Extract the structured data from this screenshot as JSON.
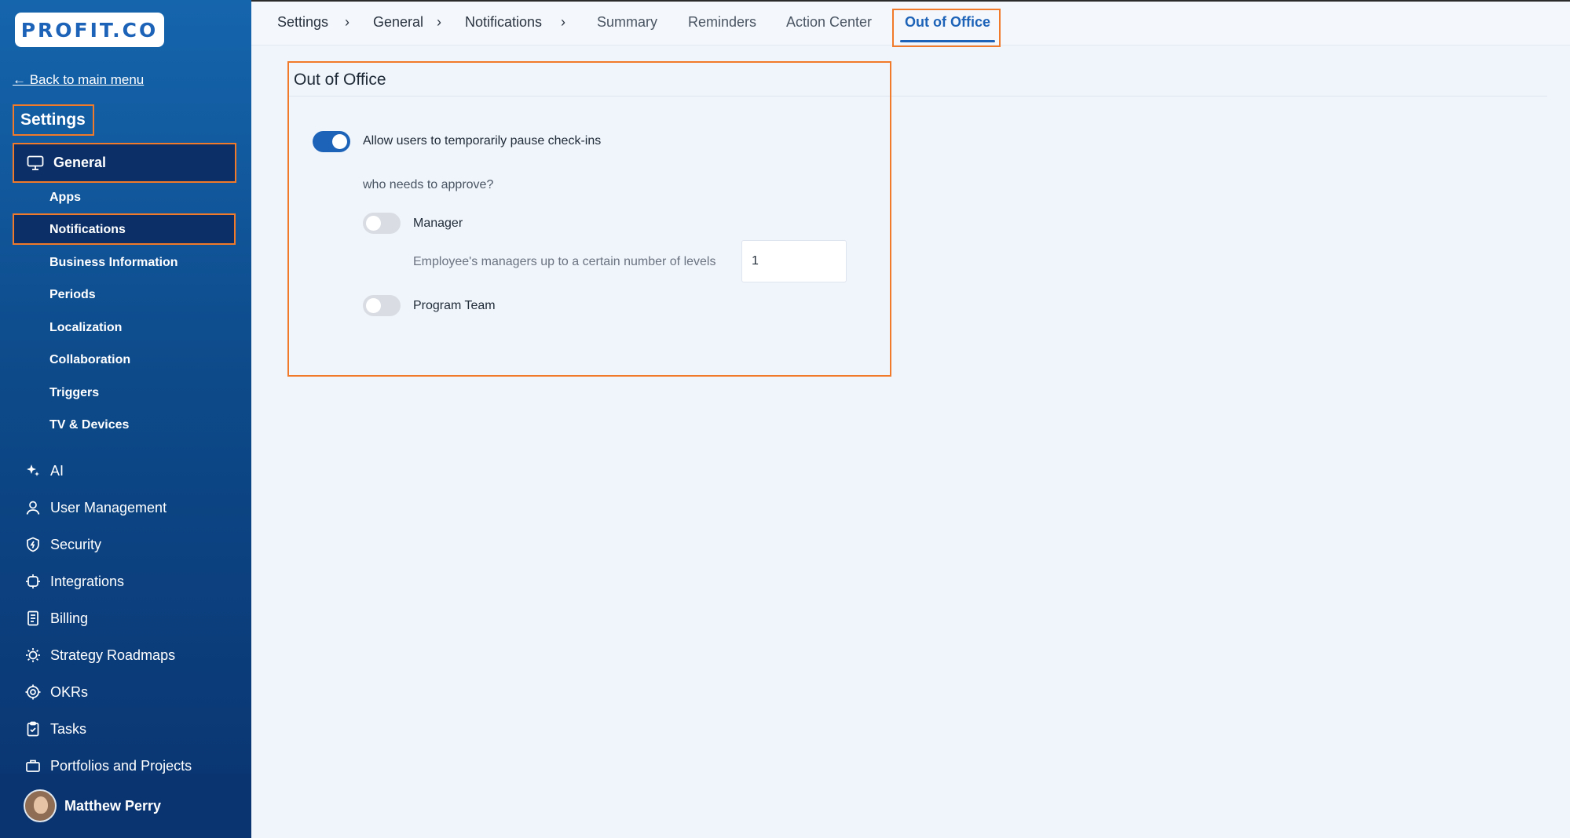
{
  "logo": {
    "text": "PROFIT.CO"
  },
  "sidebar": {
    "back_link": "← Back to main menu",
    "section_title": "Settings",
    "general": "General",
    "sub_items": [
      "Apps",
      "Notifications",
      "Business Information",
      "Periods",
      "Localization",
      "Collaboration",
      "Triggers",
      "TV & Devices"
    ],
    "main_items": [
      {
        "label": "AI",
        "icon": "sparkle-icon"
      },
      {
        "label": "User Management",
        "icon": "user-icon"
      },
      {
        "label": "Security",
        "icon": "shield-icon"
      },
      {
        "label": "Integrations",
        "icon": "integration-icon"
      },
      {
        "label": "Billing",
        "icon": "receipt-icon"
      },
      {
        "label": "Strategy Roadmaps",
        "icon": "lightbulb-icon"
      },
      {
        "label": "OKRs",
        "icon": "target-icon"
      },
      {
        "label": "Tasks",
        "icon": "clipboard-icon"
      },
      {
        "label": "Portfolios and Projects",
        "icon": "briefcase-icon"
      }
    ],
    "user_name": "Matthew Perry"
  },
  "breadcrumb": {
    "items": [
      "Settings",
      "General",
      "Notifications"
    ],
    "separator": "›"
  },
  "tabs": [
    "Summary",
    "Reminders",
    "Action Center",
    "Out of Office"
  ],
  "active_tab": "Out of Office",
  "panel": {
    "title": "Out of Office",
    "allow_pause_label": "Allow users to temporarily pause check-ins",
    "allow_pause_enabled": true,
    "approve_question": "who needs to approve?",
    "manager_label": "Manager",
    "manager_enabled": false,
    "levels_label": "Employee's managers up to a certain number of levels",
    "levels_value": "1",
    "program_team_label": "Program Team",
    "program_team_enabled": false
  },
  "colors": {
    "accent": "#1d63b8",
    "highlight_border": "#f07a2a",
    "sidebar_dark": "#0b2f66"
  }
}
